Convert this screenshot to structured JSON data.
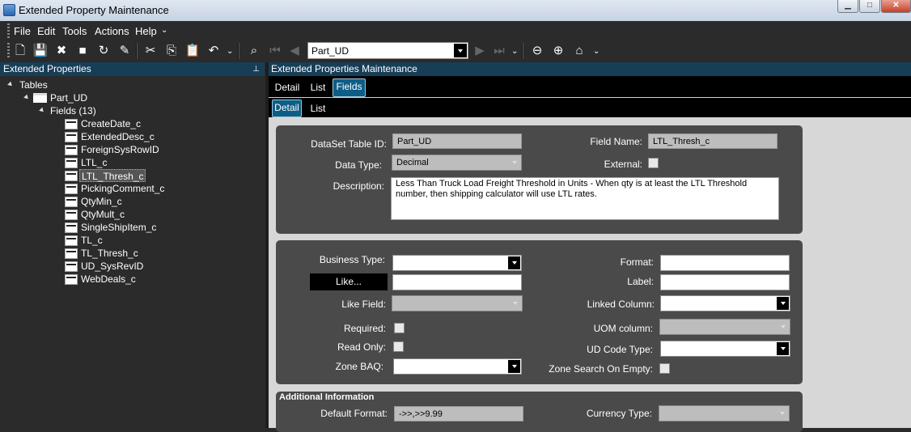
{
  "window": {
    "title": "Extended Property Maintenance"
  },
  "menu": [
    "File",
    "Edit",
    "Tools",
    "Actions",
    "Help"
  ],
  "toolbar": {
    "nav_value": "Part_UD"
  },
  "left": {
    "header": "Extended Properties",
    "tree_root": "Tables",
    "table": "Part_UD",
    "fields_node": "Fields (13)",
    "fields": [
      "CreateDate_c",
      "ExtendedDesc_c",
      "ForeignSysRowID",
      "LTL_c",
      "LTL_Thresh_c",
      "PickingComment_c",
      "QtyMin_c",
      "QtyMult_c",
      "SingleShipItem_c",
      "TL_c",
      "TL_Thresh_c",
      "UD_SysRevID",
      "WebDeals_c"
    ],
    "selected_field": "LTL_Thresh_c"
  },
  "right": {
    "header": "Extended Properties Maintenance",
    "tabs1": [
      "Detail",
      "List",
      "Fields"
    ],
    "tabs2": [
      "Detail",
      "List"
    ]
  },
  "form": {
    "dataset_label": "DataSet Table ID:",
    "dataset_value": "Part_UD",
    "fieldname_label": "Field Name:",
    "fieldname_value": "LTL_Thresh_c",
    "datatype_label": "Data Type:",
    "datatype_value": "Decimal",
    "external_label": "External:",
    "description_label": "Description:",
    "description_value": "Less Than Truck Load Freight Threshold in Units -  When qty is at least the LTL Threshold number, then shipping calculator will use LTL rates.",
    "business_type_label": "Business Type:",
    "like_button": "Like...",
    "like_field_label": "Like Field:",
    "required_label": "Required:",
    "readonly_label": "Read Only:",
    "zone_baq_label": "Zone BAQ:",
    "format_label": "Format:",
    "label_label": "Label:",
    "linked_column_label": "Linked Column:",
    "uom_column_label": "UOM column:",
    "ud_code_type_label": "UD Code Type:",
    "zone_search_label": "Zone Search On Empty:",
    "additional_header": "Additional Information",
    "default_format_label": "Default Format:",
    "default_format_value": "->>,>>9.99",
    "currency_type_label": "Currency Type:"
  }
}
